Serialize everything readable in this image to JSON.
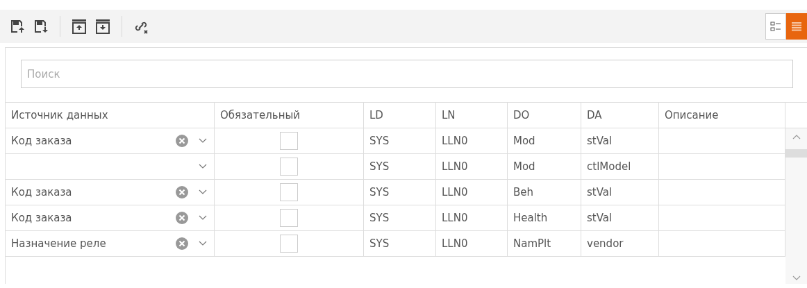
{
  "toolbar": {
    "buttons": [
      {
        "kind": "save-up"
      },
      {
        "kind": "save-down"
      },
      {
        "kind": "sep"
      },
      {
        "kind": "box-up"
      },
      {
        "kind": "box-down"
      },
      {
        "kind": "sep"
      },
      {
        "kind": "unlink"
      }
    ],
    "views": [
      {
        "kind": "tree",
        "selected": false
      },
      {
        "kind": "list",
        "selected": true
      }
    ]
  },
  "search": {
    "placeholder": "Поиск"
  },
  "table": {
    "columns": [
      "Источник данных",
      "Обязательный",
      "LD",
      "LN",
      "DO",
      "DA",
      "Описание"
    ],
    "rows": [
      {
        "source": "Код заказа",
        "clearable": true,
        "required": false,
        "ld": "SYS",
        "ln": "LLN0",
        "do": "Mod",
        "da": "stVal"
      },
      {
        "clearable": false,
        "required": false,
        "ld": "SYS",
        "ln": "LLN0",
        "do": "Mod",
        "da": "ctlModel"
      },
      {
        "source": "Код заказа",
        "clearable": true,
        "required": false,
        "ld": "SYS",
        "ln": "LLN0",
        "do": "Beh",
        "da": "stVal"
      },
      {
        "source": "Код заказа",
        "clearable": true,
        "required": false,
        "ld": "SYS",
        "ln": "LLN0",
        "do": "Health",
        "da": "stVal"
      },
      {
        "source": "Назначение реле",
        "clearable": true,
        "required": false,
        "ld": "SYS",
        "ln": "LLN0",
        "do": "NamPlt",
        "da": "vendor"
      }
    ]
  }
}
